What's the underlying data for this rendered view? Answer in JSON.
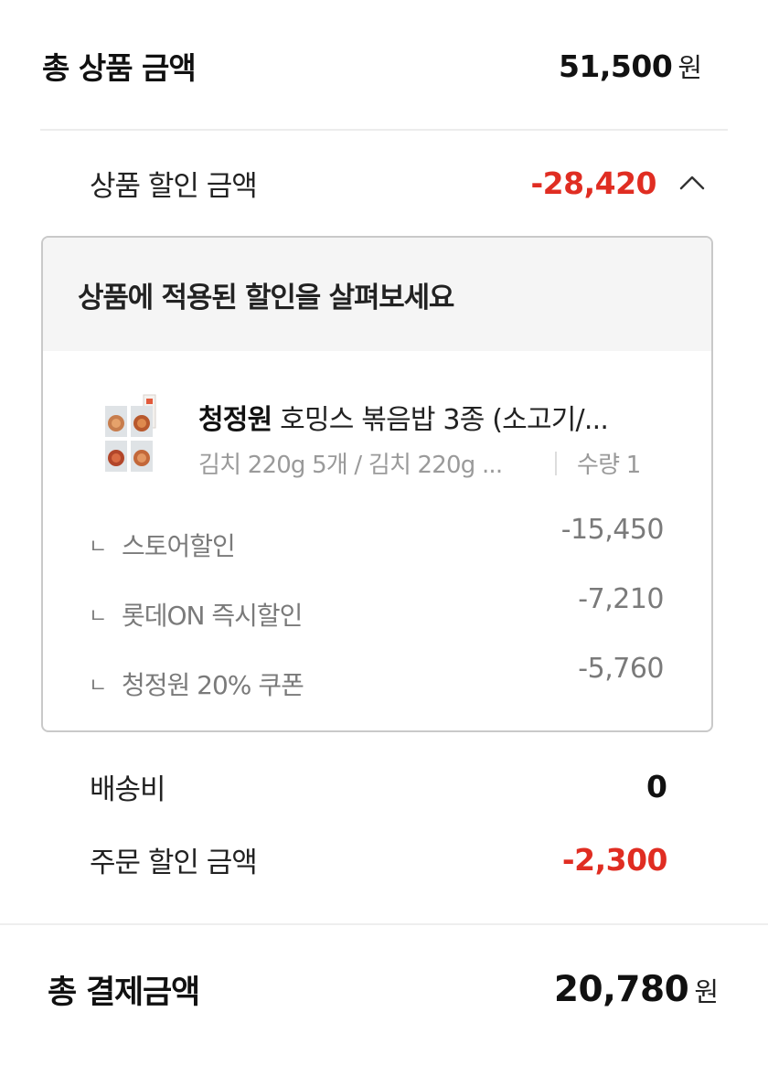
{
  "summary": {
    "total_product_label": "총 상품 금액",
    "total_product_amount": "51,500",
    "currency": "원",
    "product_discount_label": "상품 할인 금액",
    "product_discount_amount": "-28,420",
    "toggle_icon": "chevron-up-icon"
  },
  "discount_detail": {
    "heading": "상품에 적용된 할인을 살펴보세요",
    "product": {
      "brand": "청정원",
      "name": "호밍스 볶음밥 3종 (소고기/...",
      "option": "김치 220g 5개 / 김치 220g ...",
      "quantity": "수량 1",
      "thumbnail_icon": "product-thumbnail"
    },
    "mark": "ㄴ",
    "items": [
      {
        "name": "스토어할인",
        "amount": "-15,450"
      },
      {
        "name": "롯데ON 즉시할인",
        "amount": "-7,210"
      },
      {
        "name": "청정원 20% 쿠폰",
        "amount": "-5,760"
      }
    ]
  },
  "shipping": {
    "label": "배송비",
    "amount": "0"
  },
  "order_discount": {
    "label": "주문 할인 금액",
    "amount": "-2,300"
  },
  "total_payment": {
    "label": "총 결제금액",
    "amount": "20,780",
    "currency": "원"
  },
  "colors": {
    "discount_red": "#e02d22",
    "muted_gray": "#7a7a7a",
    "header_bg": "#f5f5f5"
  }
}
